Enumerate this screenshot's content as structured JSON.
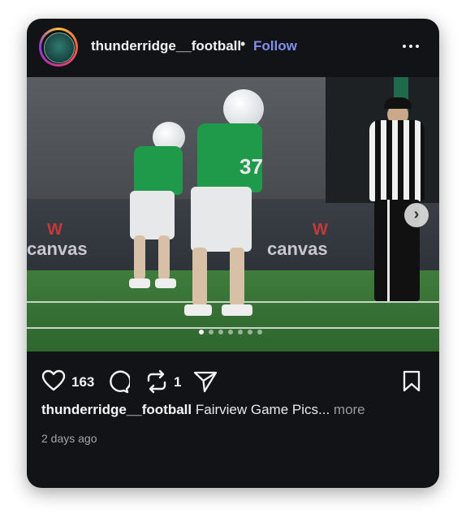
{
  "post": {
    "username": "thunderridge__football",
    "separator": "•",
    "follow_label": "Follow",
    "more_options_icon": "more-horizontal-icon",
    "avatar_icon": "team-logo-avatar",
    "photo": {
      "description_icon": "football-players-photo",
      "banner_text_left": "canvas",
      "banner_text_right": "canvas",
      "jersey_number": "37",
      "carousel_total": 7,
      "carousel_active_index": 0,
      "next_icon": "chevron-right-icon",
      "next_glyph": "›"
    },
    "actions": {
      "like_icon": "heart-icon",
      "like_count": "163",
      "comment_icon": "comment-icon",
      "repost_icon": "repost-icon",
      "repost_count": "1",
      "share_icon": "send-icon",
      "save_icon": "bookmark-icon"
    },
    "caption": {
      "username": "thunderridge__football",
      "text": "Fairview Game Pics...",
      "more_label": "more"
    },
    "timestamp": "2 days ago"
  },
  "colors": {
    "card_background": "#121316",
    "follow_link": "#7e8ff0",
    "jersey_green": "#1f9a4a",
    "muted_text": "#9a9a9a"
  }
}
